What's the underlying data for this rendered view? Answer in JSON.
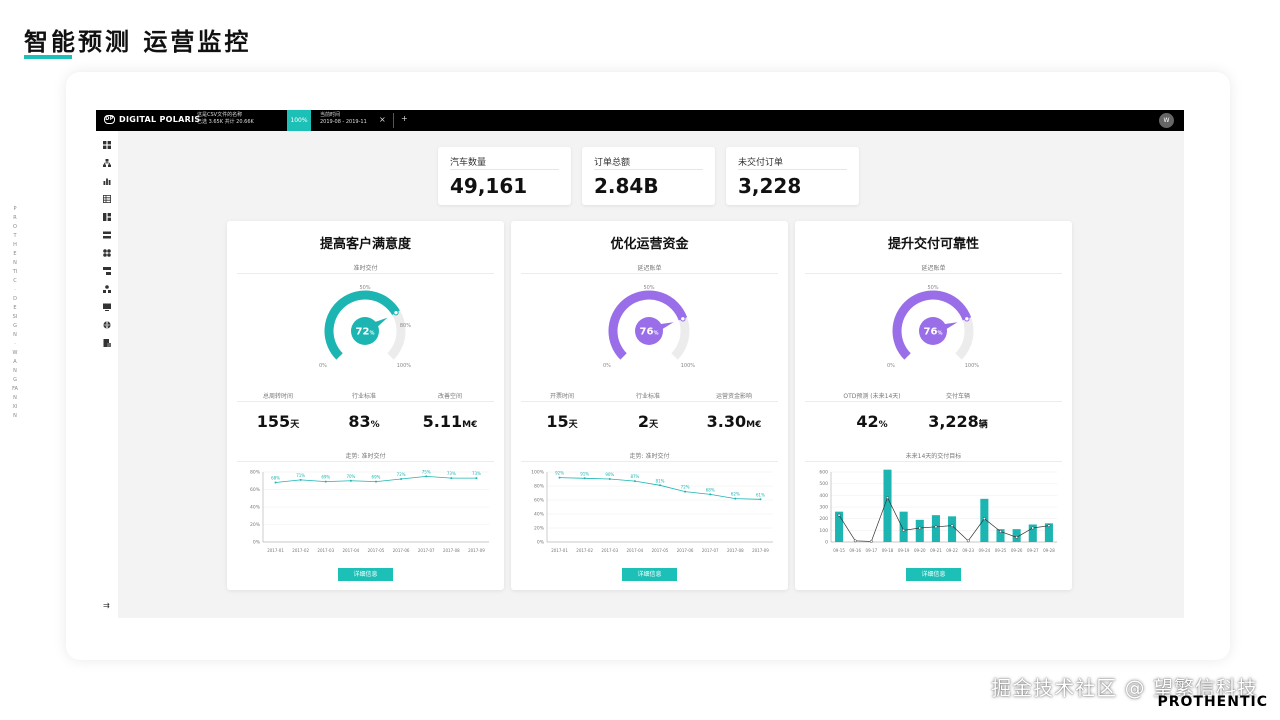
{
  "slide": {
    "title": "智能预测 运营监控",
    "side_text": "PROTHENTIC · DESIGN · WANGFANXIN",
    "watermark": "掘金技术社区 @ 望繁信科技",
    "brand_footer": "PROTHENTIC"
  },
  "app": {
    "brand": "DIGITAL POLARIS",
    "brand_logo": "DP",
    "tab1": {
      "title": "这是CSV文件的名称",
      "detail": "已选 3.65K   共计 20.66K"
    },
    "tab_progress": "100%",
    "tab2": {
      "title": "当前时间",
      "detail": "2019-08 - 2019-11"
    },
    "tab2_close": "×",
    "tab_add": "+",
    "avatar": "W"
  },
  "sidebar": {
    "icons": [
      "dashboard-icon",
      "process-map-icon",
      "bar-chart-icon",
      "table-icon",
      "grid-icon",
      "list-icon",
      "cluster-icon",
      "flow-icon",
      "org-icon",
      "monitor-icon",
      "globe-icon",
      "report-icon"
    ],
    "collapse_glyph": "⇉"
  },
  "kpis": [
    {
      "label": "汽车数量",
      "value": "49,161"
    },
    {
      "label": "订单总额",
      "value": "2.84B"
    },
    {
      "label": "未交付订单",
      "value": "3,228"
    }
  ],
  "cards": [
    {
      "title": "提高客户满意度",
      "gauge_label": "准时交付",
      "gauge_value": "72",
      "gauge_unit": "%",
      "gauge_fraction": 0.72,
      "gauge_color": "#1cb5b2",
      "gauge_ticks": [
        "50%",
        "80%",
        "0%",
        "100%"
      ],
      "metrics": [
        {
          "label": "总周转时间",
          "value": "155",
          "unit": "天"
        },
        {
          "label": "行业标准",
          "value": "83",
          "unit": "%"
        },
        {
          "label": "改善空间",
          "value": "5.11",
          "unit": "M€"
        }
      ],
      "chart_label": "走势:  准时交付",
      "button": "详细信息"
    },
    {
      "title": "优化运营资金",
      "gauge_label": "延迟账单",
      "gauge_value": "76",
      "gauge_unit": "%",
      "gauge_fraction": 0.76,
      "gauge_color": "#9a6ee8",
      "gauge_ticks": [
        "50%",
        "",
        "0%",
        "100%"
      ],
      "metrics": [
        {
          "label": "开票时间",
          "value": "15",
          "unit": "天"
        },
        {
          "label": "行业标准",
          "value": "2",
          "unit": "天"
        },
        {
          "label": "运营资金影响",
          "value": "3.30",
          "unit": "M€"
        }
      ],
      "chart_label": "走势:  准时交付",
      "button": "详细信息"
    },
    {
      "title": "提升交付可靠性",
      "gauge_label": "延迟账单",
      "gauge_value": "76",
      "gauge_unit": "%",
      "gauge_fraction": 0.76,
      "gauge_color": "#9a6ee8",
      "gauge_ticks": [
        "50%",
        "",
        "0%",
        "100%"
      ],
      "metrics": [
        {
          "label": "OTD预测 (未来14天)",
          "value": "42",
          "unit": "%"
        },
        {
          "label": "交付车辆",
          "value": "3,228",
          "unit": "辆"
        }
      ],
      "chart_label": "未来14天的交付目标",
      "button": "详细信息"
    }
  ],
  "chart_data": [
    {
      "type": "line",
      "title": "",
      "x": [
        "2017-01",
        "2017-02",
        "2017-03",
        "2017-04",
        "2017-05",
        "2017-06",
        "2017-07",
        "2017-08",
        "2017-09"
      ],
      "series": [
        {
          "values": [
            68,
            71,
            69,
            70,
            69,
            72,
            75,
            73,
            73
          ]
        }
      ],
      "point_labels": [
        "68%",
        "71%",
        "69%",
        "70%",
        "69%",
        "72%",
        "75%",
        "73%",
        "73%"
      ],
      "ylim": [
        0,
        80
      ],
      "yticks": [
        "0%",
        "20%",
        "40%",
        "60%",
        "80%"
      ],
      "color": "#1cb5b2"
    },
    {
      "type": "line",
      "title": "",
      "x": [
        "2017-01",
        "2017-02",
        "2017-03",
        "2017-04",
        "2017-05",
        "2017-06",
        "2017-07",
        "2017-08",
        "2017-09"
      ],
      "series": [
        {
          "values": [
            92,
            91,
            90,
            87,
            81,
            72,
            68,
            62,
            61
          ]
        }
      ],
      "point_labels": [
        "92%",
        "91%",
        "90%",
        "87%",
        "81%",
        "72%",
        "68%",
        "62%",
        "61%"
      ],
      "ylim": [
        0,
        100
      ],
      "yticks": [
        "0%",
        "20%",
        "40%",
        "60%",
        "80%",
        "100%"
      ],
      "color": "#1cb5b2"
    },
    {
      "type": "bar",
      "title": "",
      "x": [
        "09-15",
        "09-16",
        "09-17",
        "09-18",
        "09-19",
        "09-20",
        "09-21",
        "09-22",
        "09-23",
        "09-24",
        "09-25",
        "09-26",
        "09-27",
        "09-28"
      ],
      "series": [
        {
          "type": "bar",
          "values": [
            260,
            0,
            0,
            620,
            260,
            190,
            230,
            220,
            0,
            370,
            110,
            110,
            150,
            160
          ]
        },
        {
          "type": "line",
          "values": [
            230,
            10,
            5,
            380,
            100,
            120,
            130,
            140,
            10,
            200,
            90,
            40,
            120,
            140
          ]
        }
      ],
      "ylim": [
        0,
        600
      ],
      "yticks": [
        "0",
        "100",
        "200",
        "300",
        "400",
        "500",
        "600"
      ],
      "color": "#1cb5b2"
    }
  ]
}
